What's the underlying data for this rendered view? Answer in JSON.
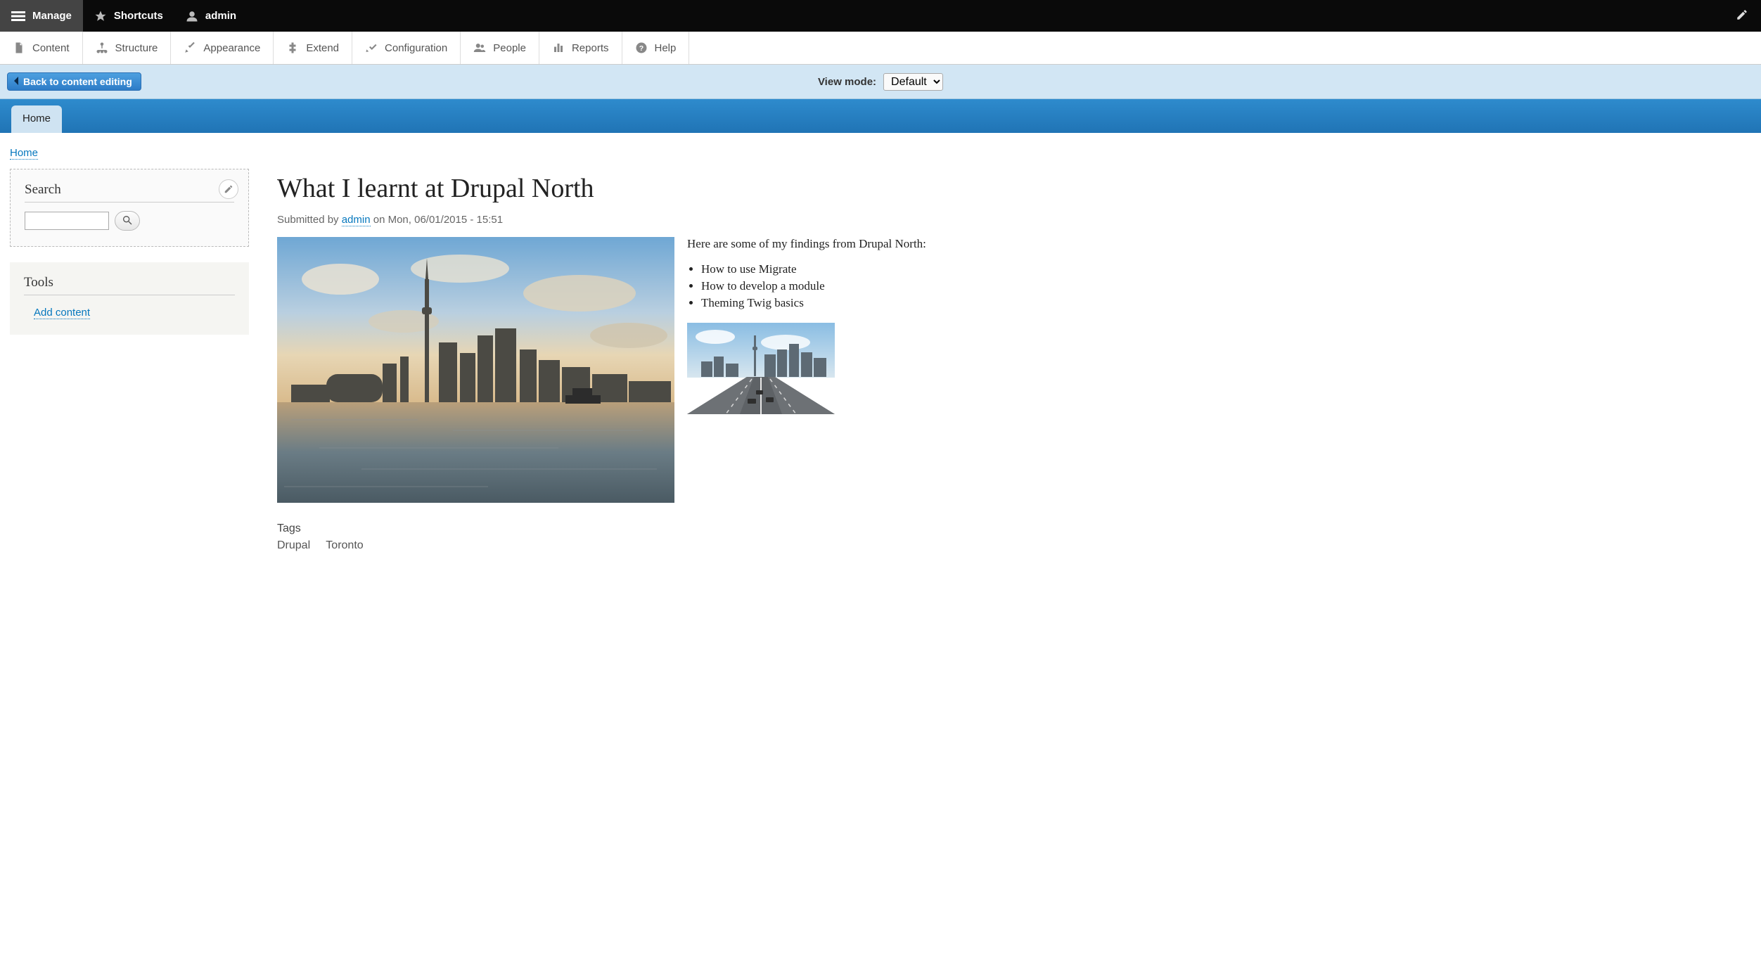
{
  "topbar": {
    "manage": "Manage",
    "shortcuts": "Shortcuts",
    "user": "admin"
  },
  "admin_menu": [
    {
      "icon": "doc-icon",
      "label": "Content"
    },
    {
      "icon": "structure-icon",
      "label": "Structure"
    },
    {
      "icon": "appearance-icon",
      "label": "Appearance"
    },
    {
      "icon": "extend-icon",
      "label": "Extend"
    },
    {
      "icon": "config-icon",
      "label": "Configuration"
    },
    {
      "icon": "people-icon",
      "label": "People"
    },
    {
      "icon": "reports-icon",
      "label": "Reports"
    },
    {
      "icon": "help-icon",
      "label": "Help"
    }
  ],
  "preview": {
    "back_label": "Back to content editing",
    "view_mode_label": "View mode:",
    "view_mode_selected": "Default"
  },
  "tabs": {
    "home": "Home"
  },
  "breadcrumb": {
    "home": "Home"
  },
  "sidebar": {
    "search": {
      "title": "Search",
      "value": ""
    },
    "tools": {
      "title": "Tools",
      "add_content": "Add content"
    }
  },
  "article": {
    "title": "What I learnt at Drupal North",
    "submitted_prefix": "Submitted by ",
    "author": "admin",
    "submitted_suffix": " on Mon, 06/01/2015 - 15:51",
    "intro": "Here are some of my findings from Drupal North:",
    "bullets": [
      "How to use Migrate",
      "How to develop a module",
      "Theming Twig basics"
    ],
    "tags_label": "Tags",
    "tags": [
      "Drupal",
      "Toronto"
    ]
  }
}
